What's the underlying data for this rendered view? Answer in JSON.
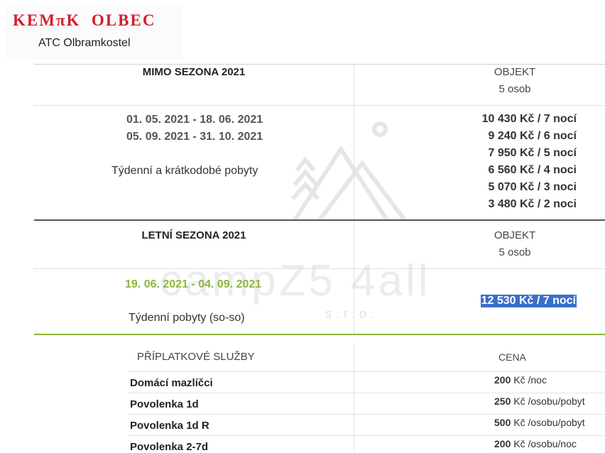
{
  "logo": {
    "title": "KEMπK  OLBEC",
    "subtitle": "ATC Olbramkostel"
  },
  "watermark": {
    "text": "campZ5 4all",
    "sub": "s.r.o."
  },
  "off_season": {
    "title": "MIMO SEZONA 2021",
    "object_label": "OBJEKT",
    "capacity": "5 osob",
    "dates": [
      "01. 05. 2021 - 18. 06. 2021",
      "05. 09. 2021 - 31. 10. 2021"
    ],
    "note": "Týdenní a krátkodobé pobyty",
    "prices": [
      "10 430 Kč / 7 nocí",
      "9 240 Kč / 6 nocí",
      "7 950 Kč / 5 nocí",
      "6 560 Kč / 4 noci",
      "5 070 Kč / 3 noci",
      "3 480 Kč / 2 noci"
    ]
  },
  "summer_season": {
    "title": "LETNÍ SEZONA 2021",
    "object_label": "OBJEKT",
    "capacity": "5 osob",
    "dates": "19. 06. 2021 - 04. 09. 2021",
    "note": "Týdenní pobyty (so-so)",
    "price": "12 530 Kč / 7 nocí"
  },
  "services": {
    "header": "PŘÍPLATKOVÉ SLUŽBY",
    "price_header": "CENA",
    "items": [
      {
        "name": "Domácí mazlíčci",
        "amount": "200",
        "unit": "Kč /noc"
      },
      {
        "name": "Povolenka 1d",
        "amount": "250",
        "unit": "Kč /osobu/pobyt"
      },
      {
        "name": "Povolenka 1d R",
        "amount": "500",
        "unit": "Kč /osobu/pobyt"
      },
      {
        "name": "Povolenka 2-7d",
        "amount": "200",
        "unit": "Kč /osobu/noc"
      }
    ]
  },
  "colors": {
    "brand_red": "#d2202f",
    "season_green": "#8fb43c",
    "selection_blue": "#3a6fc9"
  }
}
